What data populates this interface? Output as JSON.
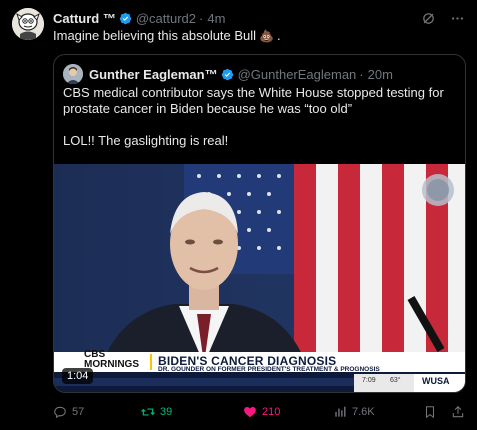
{
  "post": {
    "author_name": "Catturd ™",
    "author_handle": "@catturd2",
    "separator": "·",
    "time": "4m",
    "text": "Imagine believing this absolute Bull",
    "text_emoji": "💩",
    "text_end": "."
  },
  "quote": {
    "author_name": "Gunther Eagleman™",
    "author_handle": "@GuntherEagleman",
    "separator": "·",
    "time": "20m",
    "line1": "CBS medical contributor says the White House stopped testing for prostate cancer in Biden because he was “too old”",
    "line2": "LOL!!  The gaslighting is real!",
    "video": {
      "duration": "1:04",
      "logo_top": "CBS",
      "logo_bottom": "MORNINGS",
      "headline": "BIDEN'S CANCER DIAGNOSIS",
      "subheadline": "DR. GOUNDER ON FORMER PRESIDENT'S TREATMENT & PROGNOSIS",
      "ticker_time": "7:09",
      "ticker_temp": "63°",
      "station": "WUSA"
    }
  },
  "actions": {
    "replies": "57",
    "reposts": "39",
    "likes": "210",
    "views": "7.6K"
  },
  "colors": {
    "verified": "#1d9bf0",
    "repost_active": "#00ba7c",
    "like_active": "#f91880",
    "muted": "#71767b"
  }
}
